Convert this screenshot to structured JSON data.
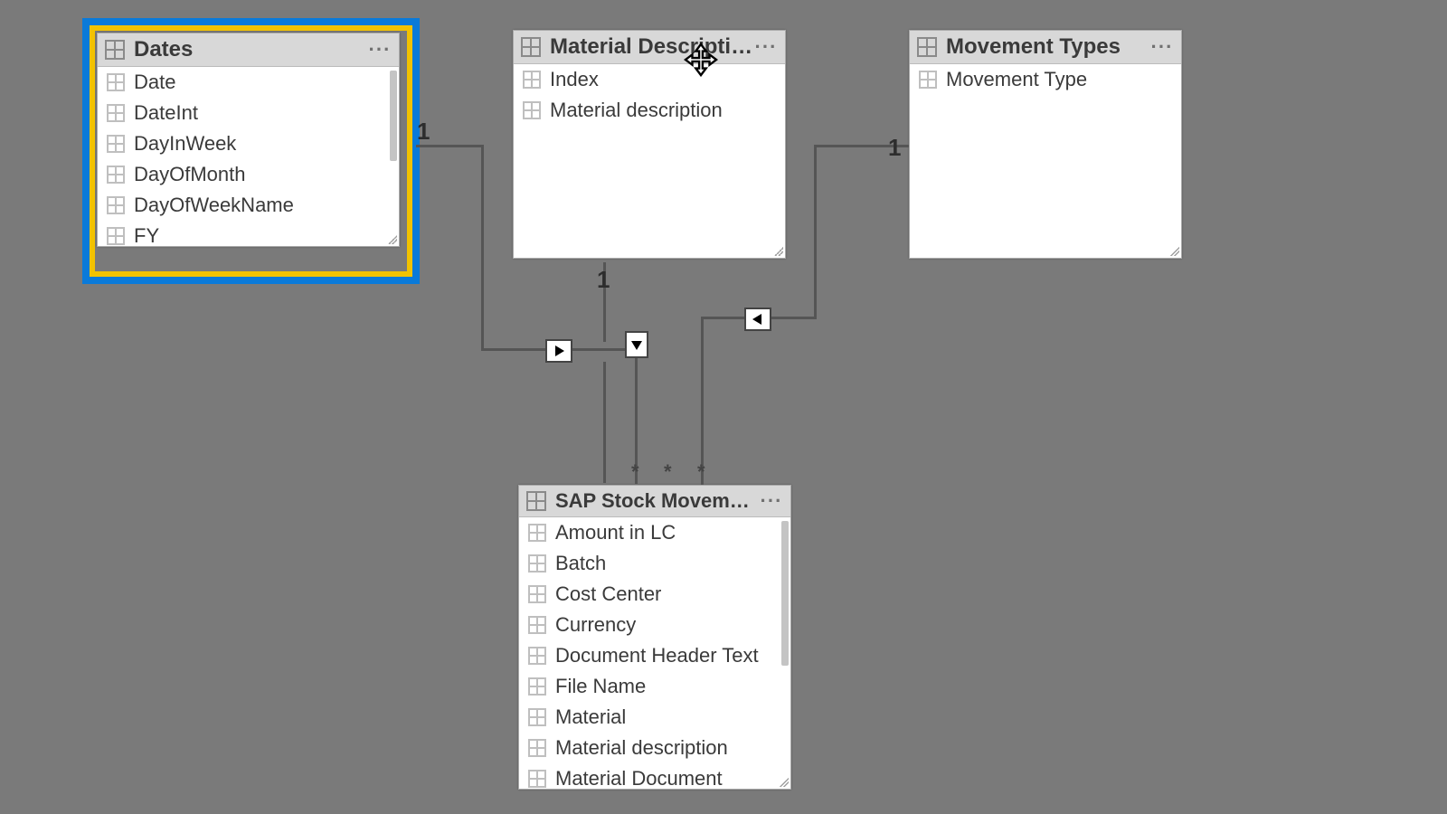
{
  "tables": {
    "dates": {
      "title": "Dates",
      "fields": [
        "Date",
        "DateInt",
        "DayInWeek",
        "DayOfMonth",
        "DayOfWeekName",
        "FY"
      ]
    },
    "material": {
      "title": "Material Description",
      "fields": [
        "Index",
        "Material description"
      ]
    },
    "movement": {
      "title": "Movement Types",
      "fields": [
        "Movement Type"
      ]
    },
    "sap": {
      "title": "SAP Stock Movements",
      "fields": [
        "Amount in LC",
        "Batch",
        "Cost Center",
        "Currency",
        "Document Header Text",
        "File Name",
        "Material",
        "Material description",
        "Material Document"
      ]
    }
  },
  "cardinalities": {
    "material_one": "1",
    "movement_one": "1"
  },
  "stars": {
    "sap_a": "*",
    "sap_b": "*",
    "sap_c": "*"
  }
}
